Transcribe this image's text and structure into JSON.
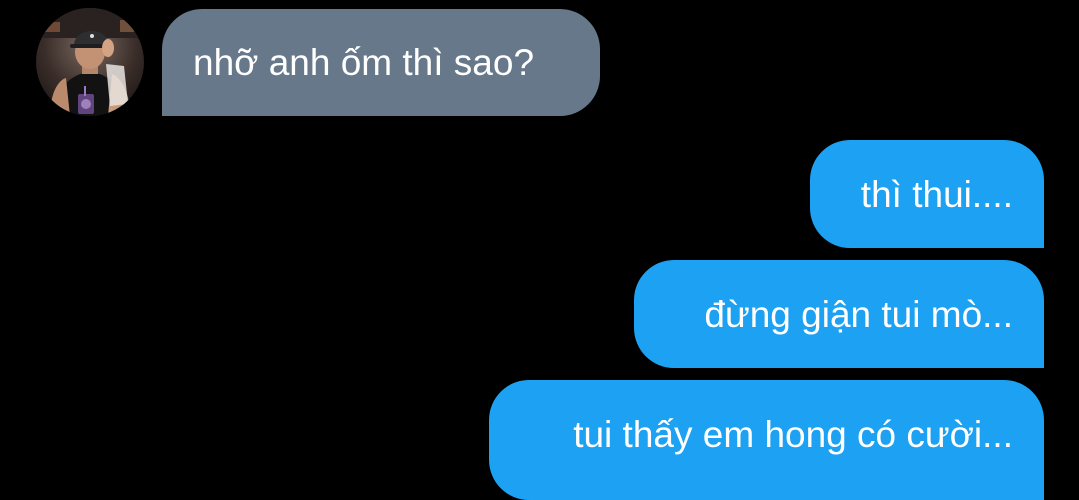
{
  "conversation": {
    "incoming": {
      "avatar_icon": "user-avatar-photo",
      "text": "nhỡ anh ốm thì sao?",
      "bubble_color": "#66788a"
    },
    "outgoing": [
      {
        "text": "thì thui...."
      },
      {
        "text": "đừng giận tui mò..."
      },
      {
        "text": "tui thấy em hong có cười..."
      }
    ],
    "outgoing_bubble_color": "#1da1f2",
    "background_color": "#000000"
  }
}
